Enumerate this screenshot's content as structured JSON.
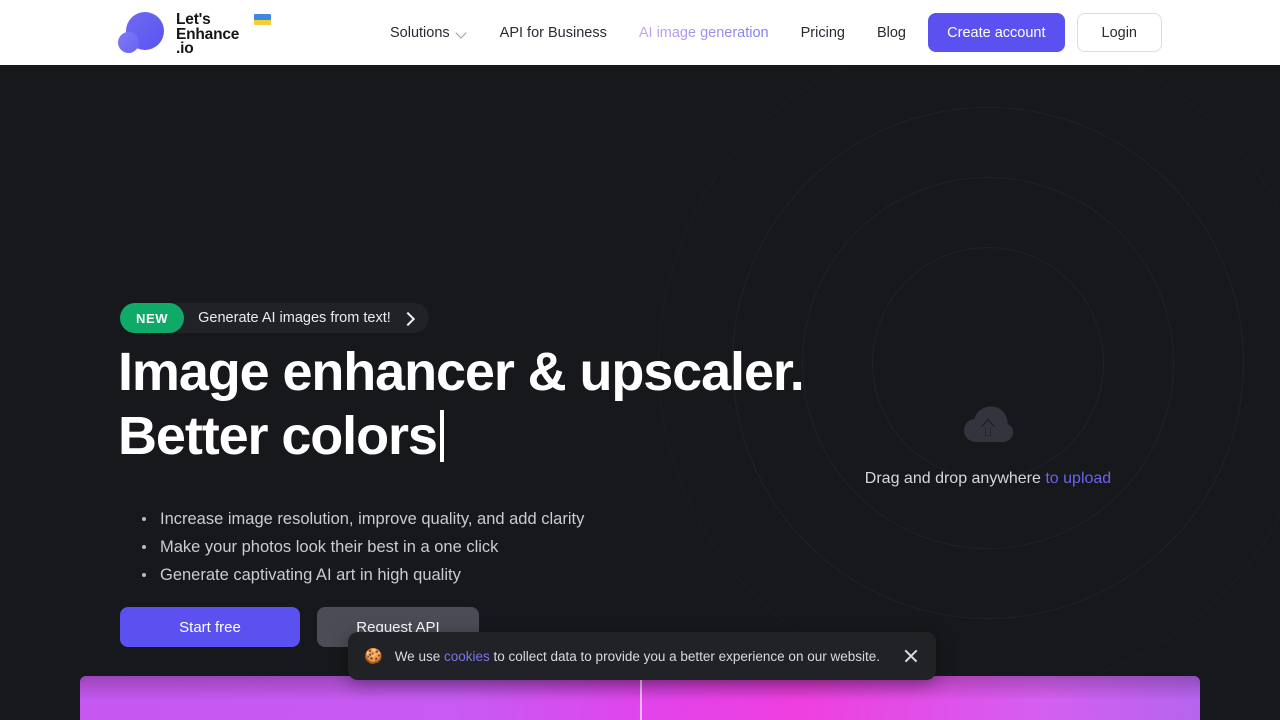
{
  "header": {
    "logo": {
      "line1": "Let's",
      "line2": "Enhance",
      "line3": ".io",
      "flag_alt": "ukraine-flag"
    },
    "nav": [
      {
        "label": "Solutions",
        "has_chevron": true,
        "accent": false
      },
      {
        "label": "API for Business",
        "has_chevron": false,
        "accent": false
      },
      {
        "label": "AI image generation",
        "has_chevron": false,
        "accent": true
      },
      {
        "label": "Pricing",
        "has_chevron": false,
        "accent": false
      },
      {
        "label": "Blog",
        "has_chevron": false,
        "accent": false
      }
    ],
    "create_account_label": "Create account",
    "login_label": "Login"
  },
  "hero": {
    "badge": {
      "tag": "NEW",
      "text": "Generate AI images from text!"
    },
    "headline_line1": "Image enhancer & upscaler.",
    "headline_line2": "Better colors",
    "bullets": [
      "Increase image resolution, improve quality, and add clarity",
      "Make your photos look their best in a one click",
      "Generate captivating AI art in high quality"
    ],
    "primary_cta": "Start free",
    "secondary_cta": "Request API",
    "dropzone": {
      "text": "Drag and drop anywhere",
      "link": "to upload",
      "icon": "cloud-upload-icon"
    }
  },
  "cookie_banner": {
    "emoji": "🍪",
    "text_before": "We use ",
    "link": "cookies",
    "text_after": " to collect data to provide you a better experience on our website.",
    "close_icon": "close-icon"
  },
  "colors": {
    "brand_purple": "#5a51f0",
    "badge_green": "#0fa968",
    "hero_background": "#17181b",
    "header_background": "#ffffff",
    "link_purple": "#7a74f0"
  }
}
